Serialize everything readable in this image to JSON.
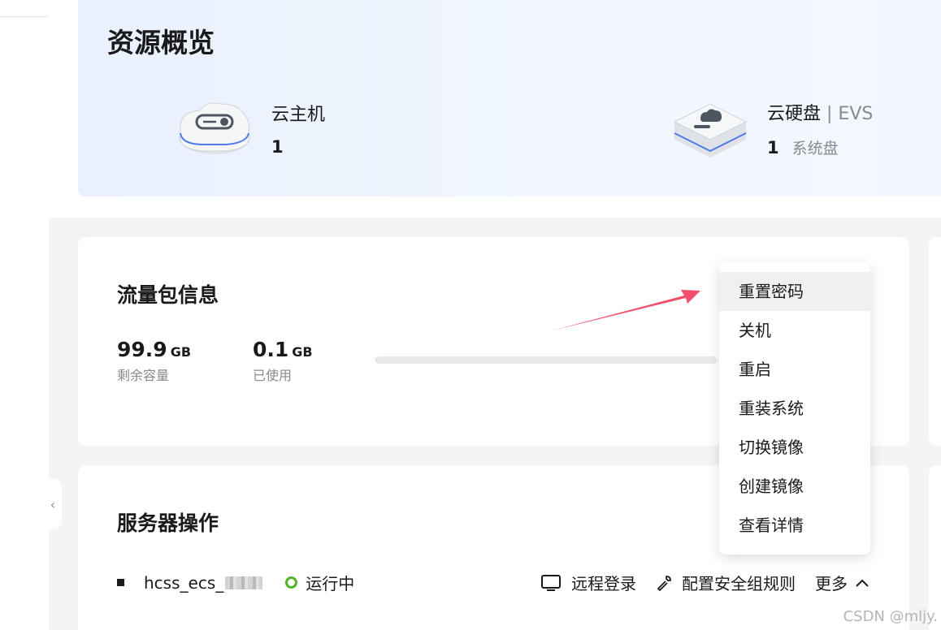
{
  "overview": {
    "title": "资源概览",
    "ecs": {
      "name": "云主机",
      "count": "1"
    },
    "evs": {
      "name": "云硬盘",
      "sub": " | EVS",
      "count": "1",
      "unit": "系统盘"
    }
  },
  "traffic": {
    "title": "流量包信息",
    "remaining_value": "99.9",
    "remaining_unit": "GB",
    "remaining_label": "剩余容量",
    "used_value": "0.1",
    "used_unit": "GB",
    "used_label": "已使用",
    "used_fraction": 0.001
  },
  "server": {
    "title": "服务器操作",
    "name": "hcss_ecs_",
    "status": "运行中",
    "status_color": "#52b52a",
    "actions": {
      "remote_login": "远程登录",
      "security_rules": "配置安全组规则",
      "more": "更多"
    }
  },
  "dropdown": {
    "items": [
      "重置密码",
      "关机",
      "重启",
      "重装系统",
      "切换镜像",
      "创建镜像",
      "查看详情"
    ],
    "highlighted_index": 0
  },
  "annotation_arrow_color": "#f0506e",
  "watermark": "CSDN @mljy."
}
